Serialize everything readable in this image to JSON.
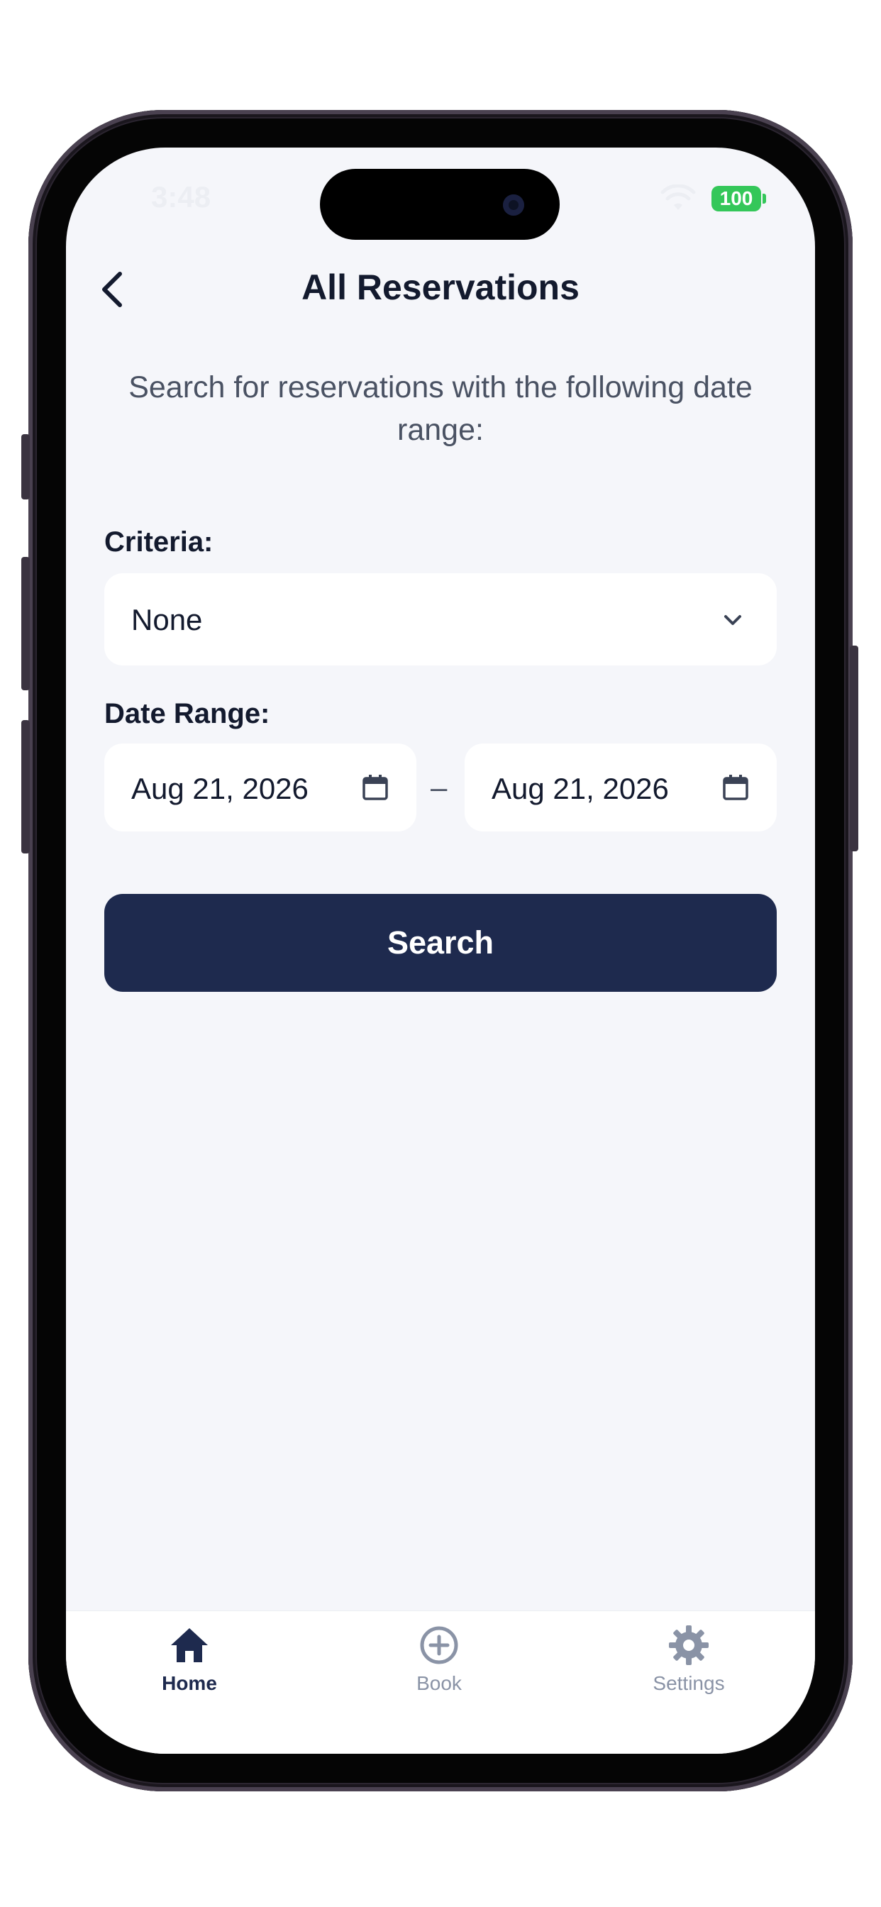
{
  "status_bar": {
    "time": "3:48",
    "battery": "100"
  },
  "header": {
    "title": "All Reservations",
    "back_icon": "chevron-left-icon"
  },
  "intro": "Search for reservations with the following date range:",
  "criteria": {
    "label": "Criteria:",
    "selected": "None"
  },
  "date_range": {
    "label": "Date Range:",
    "start": "Aug 21, 2026",
    "separator": "–",
    "end": "Aug 21, 2026"
  },
  "search_button": "Search",
  "tabs": [
    {
      "label": "Home",
      "icon": "home-icon",
      "active": true
    },
    {
      "label": "Book",
      "icon": "plus-circle-icon",
      "active": false
    },
    {
      "label": "Settings",
      "icon": "gear-icon",
      "active": false
    }
  ],
  "colors": {
    "primary": "#1e2a4e",
    "background": "#f5f6fa",
    "battery": "#34c759",
    "inactive": "#8a93a6"
  }
}
